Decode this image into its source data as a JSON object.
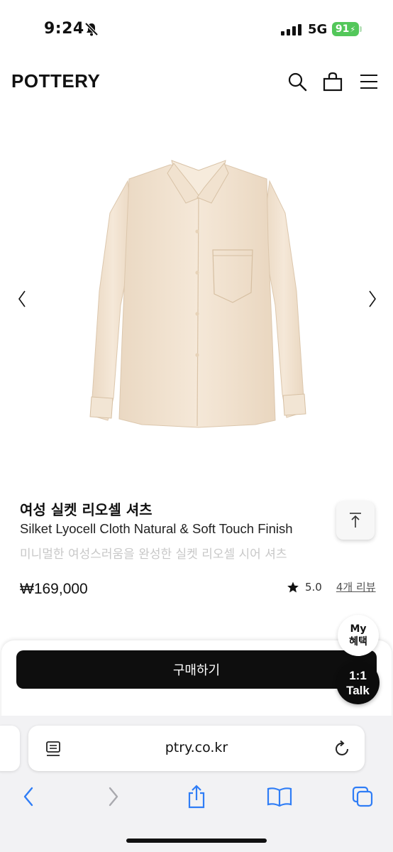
{
  "status_bar": {
    "time": "9:24",
    "network": "5G",
    "battery": "91"
  },
  "header": {
    "brand": "POTTERY"
  },
  "product": {
    "title_ko": "여성 실켓 리오셀 셔츠",
    "subtitle_en": "Silket Lyocell Cloth Natural & Soft Touch Finish",
    "description_ko": "미니멀한 여성스러움을 완성한 실켓 리오셀 시어 셔츠",
    "price": "₩169,000",
    "rating": "5.0",
    "reviews_link": "4개 리뷰",
    "image_color": "#f3e4d1"
  },
  "floating": {
    "benefit_line1": "My",
    "benefit_line2": "혜택",
    "talk_line1": "1:1",
    "talk_line2": "Talk"
  },
  "purchase": {
    "buy_label": "구매하기"
  },
  "browser": {
    "url": "ptry.co.kr"
  }
}
